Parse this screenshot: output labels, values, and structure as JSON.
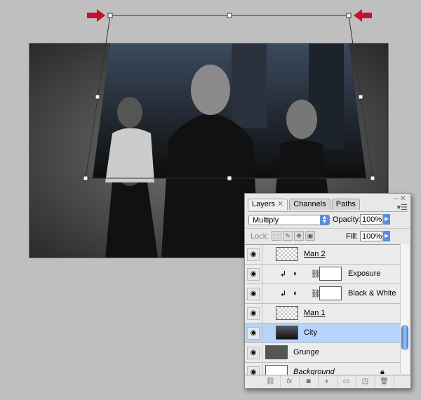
{
  "layers_panel": {
    "tabs": [
      {
        "label": "Layers"
      },
      {
        "label": "Channels"
      },
      {
        "label": "Paths"
      }
    ],
    "blend_mode": "Multiply",
    "opacity_label": "Opacity:",
    "opacity": "100%",
    "lock_label": "Lock:",
    "fill_label": "Fill:",
    "fill": "100%",
    "layers": [
      {
        "name": "Man 2",
        "visible": true
      },
      {
        "name": "Exposure",
        "visible": true,
        "type": "adjustment",
        "clipped": true
      },
      {
        "name": "Black & White",
        "visible": true,
        "type": "adjustment",
        "clipped": true
      },
      {
        "name": "Man 1",
        "visible": true
      },
      {
        "name": "City",
        "visible": true,
        "selected": true
      },
      {
        "name": "Grunge",
        "visible": true
      },
      {
        "name": "Background",
        "visible": true,
        "locked": true
      }
    ]
  },
  "colors": {
    "arrow": "#c8102e",
    "selection": "#b7d4fb",
    "accent": "#5a8de0"
  }
}
